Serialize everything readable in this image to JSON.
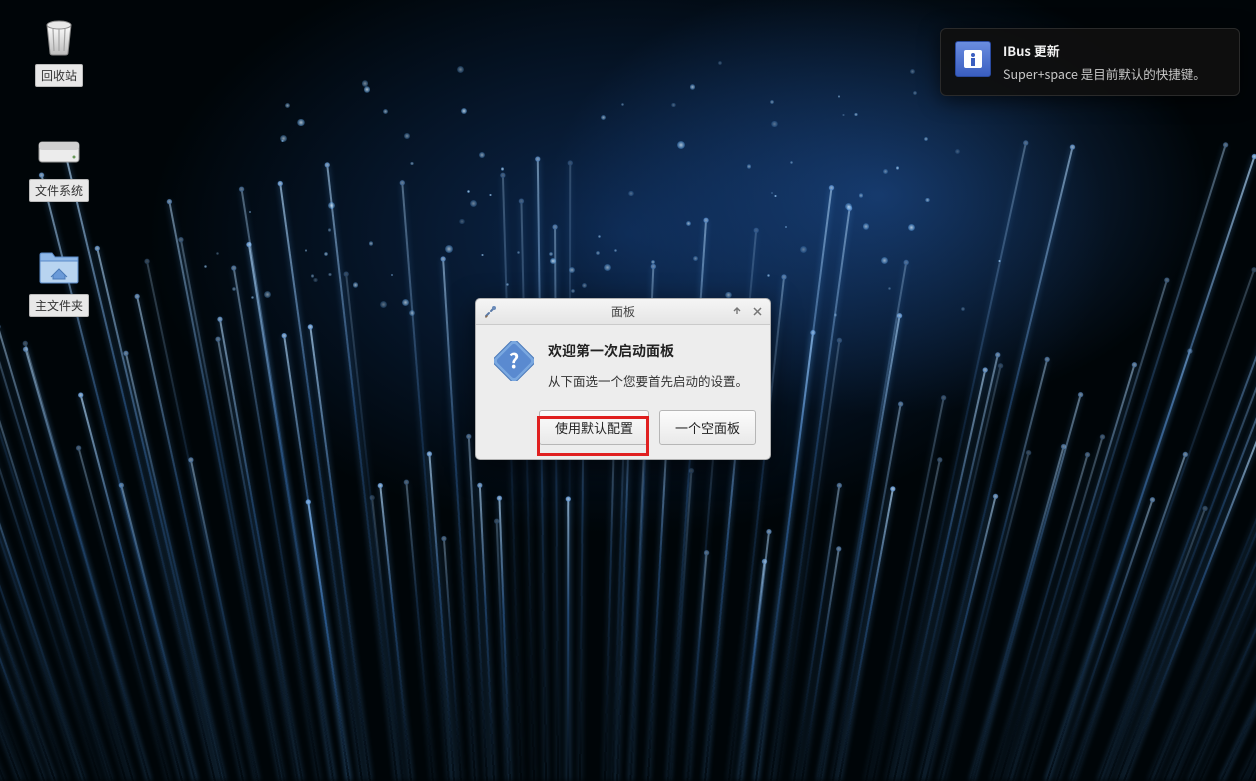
{
  "desktop_icons": [
    {
      "name": "trash",
      "label": "回收站"
    },
    {
      "name": "filesystem",
      "label": "文件系统"
    },
    {
      "name": "home",
      "label": "主文件夹"
    }
  ],
  "notification": {
    "title": "IBus 更新",
    "text": "Super+space 是目前默认的快捷键。"
  },
  "dialog": {
    "title": "面板",
    "heading": "欢迎第一次启动面板",
    "subtext": "从下面选一个您要首先启动的设置。",
    "button_default": "使用默认配置",
    "button_empty": "一个空面板"
  }
}
